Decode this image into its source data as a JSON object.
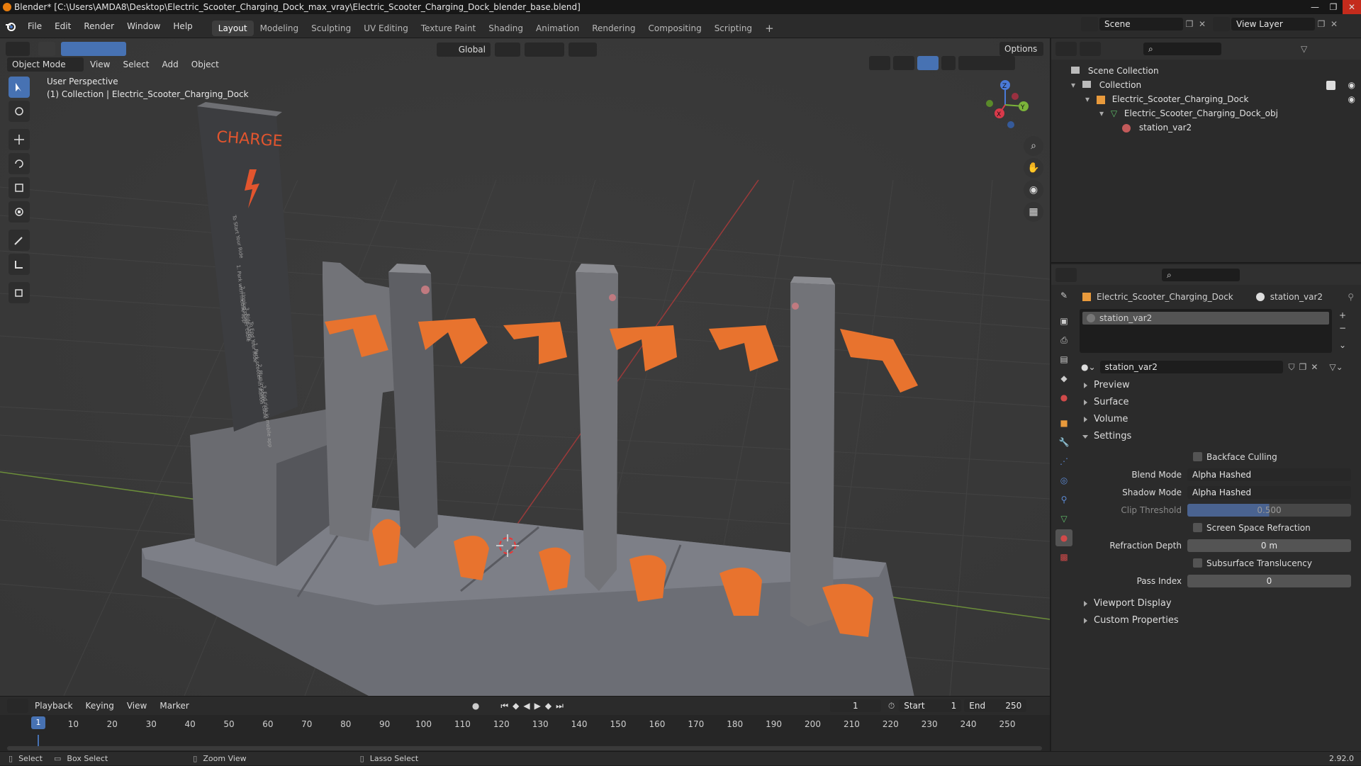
{
  "title": {
    "text": "Blender* [C:\\Users\\AMDA8\\Desktop\\Electric_Scooter_Charging_Dock_max_vray\\Electric_Scooter_Charging_Dock_blender_base.blend]",
    "controls": [
      "—",
      "❐",
      "✕"
    ]
  },
  "menu": [
    "File",
    "Edit",
    "Render",
    "Window",
    "Help"
  ],
  "workspaces": [
    "Layout",
    "Modeling",
    "Sculpting",
    "UV Editing",
    "Texture Paint",
    "Shading",
    "Animation",
    "Rendering",
    "Compositing",
    "Scripting",
    "+"
  ],
  "active_workspace": "Layout",
  "scene": {
    "label": "Scene",
    "view_layer": "View Layer"
  },
  "viewport": {
    "header": {
      "transform_orientation": "Global",
      "options": "Options"
    },
    "mode": "Object Mode",
    "menus": [
      "View",
      "Select",
      "Add",
      "Object"
    ],
    "overlay_title": "User Perspective",
    "overlay_subtitle": "(1) Collection | Electric_Scooter_Charging_Dock",
    "sign_text": "CHARGE",
    "sign_subtitle": "To Start Your Ride",
    "sign_lines": [
      "1. Park with mobile app",
      "2. Unplug power cable",
      "3. Ride safely",
      "To End Your Ride",
      "1. Park scooter in station",
      "2. Plug in power cable",
      "3. End ride in mobile app"
    ],
    "axes": {
      "x": "X",
      "y": "Y",
      "z": "Z"
    }
  },
  "outliner": {
    "items": [
      {
        "label": "Scene Collection",
        "indent": 0
      },
      {
        "label": "Collection",
        "indent": 1
      },
      {
        "label": "Electric_Scooter_Charging_Dock",
        "indent": 2
      },
      {
        "label": "Electric_Scooter_Charging_Dock_obj",
        "indent": 3
      },
      {
        "label": "station_var2",
        "indent": 4
      }
    ]
  },
  "properties": {
    "breadcrumb_object": "Electric_Scooter_Charging_Dock",
    "breadcrumb_material": "station_var2",
    "slot": "station_var2",
    "material_name": "station_var2",
    "panels_closed": [
      "Preview",
      "Surface",
      "Volume"
    ],
    "settings_label": "Settings",
    "backface_culling": "Backface Culling",
    "blend_mode_label": "Blend Mode",
    "blend_mode": "Alpha Hashed",
    "shadow_mode_label": "Shadow Mode",
    "shadow_mode": "Alpha Hashed",
    "clip_threshold_label": "Clip Threshold",
    "clip_threshold": "0.500",
    "screen_space_refraction": "Screen Space Refraction",
    "refraction_depth_label": "Refraction Depth",
    "refraction_depth": "0 m",
    "subsurface_translucency": "Subsurface Translucency",
    "pass_index_label": "Pass Index",
    "pass_index": "0",
    "viewport_display": "Viewport Display",
    "custom_properties": "Custom Properties"
  },
  "timeline": {
    "menus": [
      "Playback",
      "Keying",
      "View",
      "Marker"
    ],
    "current_frame": "1",
    "start_label": "Start",
    "start": "1",
    "end_label": "End",
    "end": "250",
    "ticks": [
      "1",
      "10",
      "20",
      "30",
      "40",
      "50",
      "60",
      "70",
      "80",
      "90",
      "100",
      "110",
      "120",
      "130",
      "140",
      "150",
      "160",
      "170",
      "180",
      "190",
      "200",
      "210",
      "220",
      "230",
      "240",
      "250"
    ]
  },
  "status": {
    "select": "Select",
    "box_select": "Box Select",
    "zoom_view": "Zoom View",
    "lasso_select": "Lasso Select",
    "version": "2.92.0"
  },
  "colors": {
    "accent": "#4772b3",
    "orange": "#e8732e",
    "viewport_bg": "#3a3a3a",
    "panel_bg": "#2b2b2b"
  }
}
